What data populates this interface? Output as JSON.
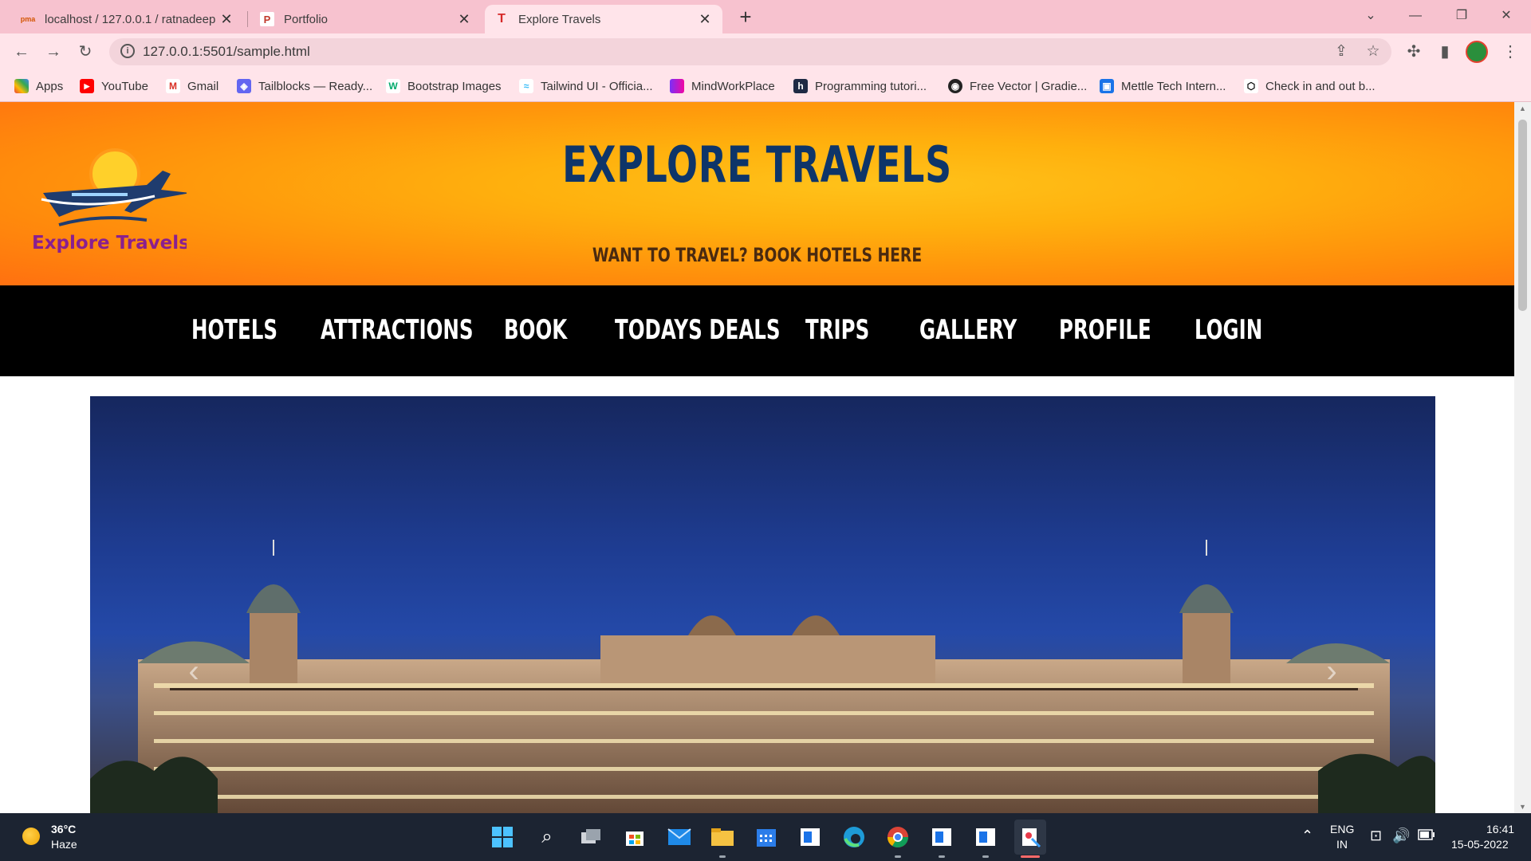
{
  "browser": {
    "tabs": [
      {
        "title": "localhost / 127.0.0.1 / ratnadeep",
        "favicon": "phpmyadmin-icon",
        "active": false
      },
      {
        "title": "Portfolio",
        "favicon": "p-logo-icon",
        "active": false
      },
      {
        "title": "Explore Travels",
        "favicon": "t-logo-icon",
        "active": true
      }
    ],
    "url": "127.0.0.1:5501/sample.html",
    "bookmarks": [
      {
        "label": "Apps",
        "icon": "apps-grid-icon"
      },
      {
        "label": "YouTube",
        "icon": "youtube-icon"
      },
      {
        "label": "Gmail",
        "icon": "gmail-icon"
      },
      {
        "label": "Tailblocks — Ready...",
        "icon": "tailblocks-icon"
      },
      {
        "label": "Bootstrap Images",
        "icon": "w3-icon"
      },
      {
        "label": "Tailwind UI - Officia...",
        "icon": "tailwind-icon"
      },
      {
        "label": "MindWorkPlace",
        "icon": "mindworkplace-icon"
      },
      {
        "label": "Programming tutori...",
        "icon": "h-logo-icon"
      },
      {
        "label": "Free Vector | Gradie...",
        "icon": "freepik-icon"
      },
      {
        "label": "Mettle Tech Intern...",
        "icon": "contact-card-icon"
      },
      {
        "label": "Check in and out b...",
        "icon": "codepen-icon"
      }
    ]
  },
  "page": {
    "logo_text": "Explore Travels",
    "title": "EXPLORE TRAVELS",
    "subtitle": "WANT TO TRAVEL? BOOK HOTELS HERE",
    "nav": [
      "HOTELS",
      "ATTRACTIONS",
      "BOOK",
      "TODAYS DEALS",
      "TRIPS",
      "GALLERY",
      "PROFILE",
      "LOGIN"
    ]
  },
  "taskbar": {
    "temperature": "36°C",
    "weather": "Haze",
    "language": "ENG",
    "region": "IN",
    "time": "16:41",
    "date": "15-05-2022"
  },
  "colors": {
    "tab_strip": "#f7c2cf",
    "toolbar": "#ffe4ea",
    "hero_orange": "#ff8c0c",
    "title_navy": "#0e3569",
    "nav_bg": "#000000",
    "logo_text": "#8a1f8f"
  }
}
